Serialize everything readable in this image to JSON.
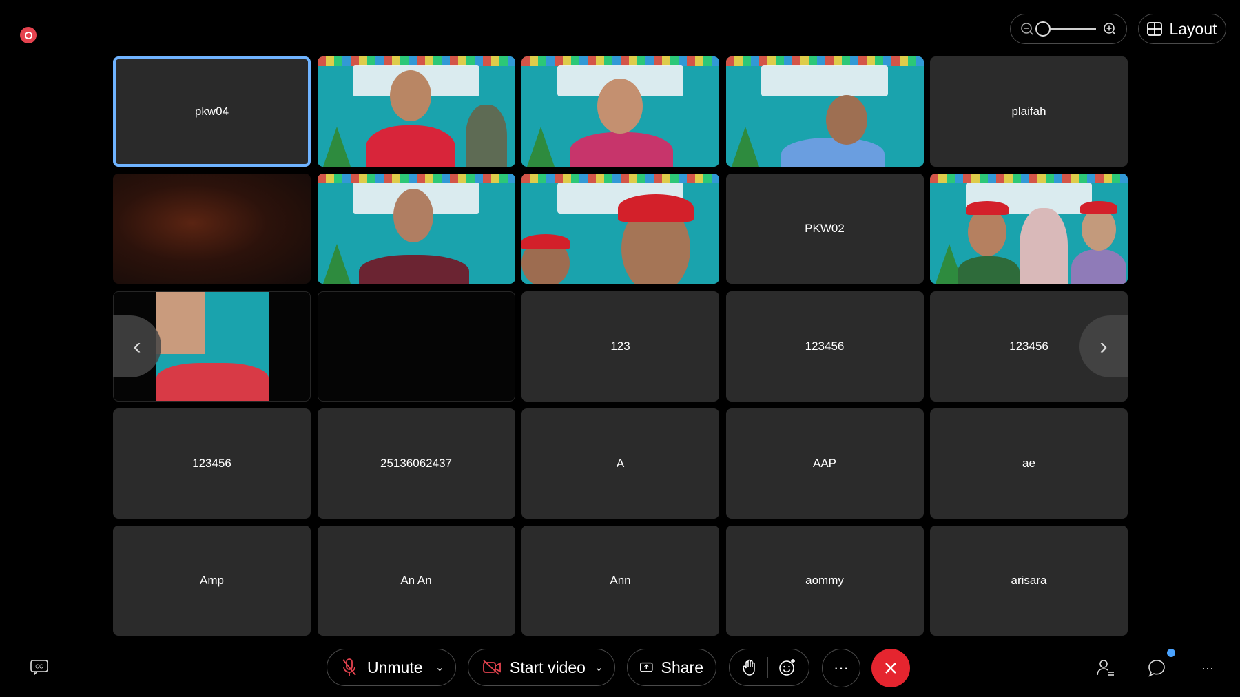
{
  "header": {
    "layout_label": "Layout"
  },
  "participants": [
    {
      "name": "pkw04"
    },
    {
      "name": ""
    },
    {
      "name": ""
    },
    {
      "name": ""
    },
    {
      "name": "plaifah"
    },
    {
      "name": ""
    },
    {
      "name": ""
    },
    {
      "name": ""
    },
    {
      "name": "PKW02"
    },
    {
      "name": ""
    },
    {
      "name": ""
    },
    {
      "name": ""
    },
    {
      "name": "123"
    },
    {
      "name": "123456"
    },
    {
      "name": "123456"
    },
    {
      "name": "123456"
    },
    {
      "name": "25136062437"
    },
    {
      "name": "A"
    },
    {
      "name": "AAP"
    },
    {
      "name": "ae"
    },
    {
      "name": "Amp"
    },
    {
      "name": "An An"
    },
    {
      "name": "Ann"
    },
    {
      "name": "aommy"
    },
    {
      "name": "arisara"
    }
  ],
  "toolbar": {
    "unmute_label": "Unmute",
    "start_video_label": "Start video",
    "share_label": "Share",
    "more_label": "···"
  },
  "colors": {
    "end_call": "#e5252f",
    "active_speaker": "#6fb3ff",
    "recording": "#e5434f",
    "notification": "#4aa3ff"
  }
}
